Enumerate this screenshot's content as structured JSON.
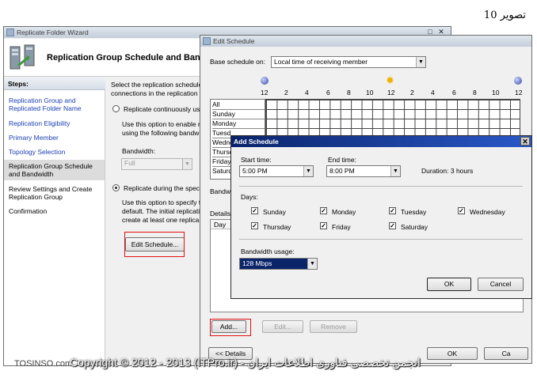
{
  "caption": "تصویر 10",
  "footer": {
    "brand": "TOSINSO.com",
    "copyright": "Copyright © 2012 - 2013 (ITPro.ir) - انجمن تخصصی فناوری اطلاعات ایران"
  },
  "wizard": {
    "title": "Replicate Folder Wizard",
    "header": "Replication Group Schedule and Ban",
    "steps_label": "Steps:",
    "steps": [
      {
        "label": "Replication Group and Replicated Folder Name"
      },
      {
        "label": "Replication Eligibility"
      },
      {
        "label": "Primary Member"
      },
      {
        "label": "Topology Selection"
      },
      {
        "label": "Replication Group Schedule and Bandwidth"
      },
      {
        "label": "Review Settings and Create Replication Group"
      },
      {
        "label": "Confirmation"
      }
    ],
    "intro": "Select the replication schedule",
    "intro2": "connections in the replication",
    "option1": "Replicate continuously us",
    "option1_desc1": "Use this option to enable r",
    "option1_desc2": "using the following bandw",
    "bandwidth_label": "Bandwidth:",
    "bandwidth_value": "Full",
    "option2": "Replicate during the speci",
    "option2_desc1": "Use this option to specify t",
    "option2_desc2": "default. The initial replicati",
    "option2_desc3": "create at least one replica",
    "edit_schedule": "Edit Schedule..."
  },
  "edit_schedule": {
    "title": "Edit Schedule",
    "base_label": "Base schedule on:",
    "base_value": "Local time of receiving member",
    "hours": [
      "12",
      "2",
      "4",
      "6",
      "8",
      "10",
      "12",
      "2",
      "4",
      "6",
      "8",
      "10",
      "12"
    ],
    "days": [
      "All",
      "Sunday",
      "Monday",
      "Tuesd",
      "Wedne",
      "Thursd",
      "Friday",
      "Saturd"
    ],
    "bandwidth_label": "Bandw",
    "details_label": "Details",
    "day_col": "Day",
    "add": "Add...",
    "edit": "Edit...",
    "remove": "Remove",
    "details_btn": "<< Details",
    "ok": "OK",
    "cancel": "Ca"
  },
  "add_schedule": {
    "title": "Add Schedule",
    "start_label": "Start time:",
    "start_value": "5:00 PM",
    "end_label": "End time:",
    "end_value": "8:00 PM",
    "duration": "Duration: 3 hours",
    "days_label": "Days:",
    "days": [
      {
        "label": "Sunday",
        "checked": true
      },
      {
        "label": "Monday",
        "checked": true
      },
      {
        "label": "Tuesday",
        "checked": true
      },
      {
        "label": "Wednesday",
        "checked": true
      },
      {
        "label": "Thursday",
        "checked": true
      },
      {
        "label": "Friday",
        "checked": true
      },
      {
        "label": "Saturday",
        "checked": true
      }
    ],
    "bandwidth_label": "Bandwidth usage:",
    "bandwidth_value": "128 Mbps",
    "ok": "OK",
    "cancel": "Cancel"
  }
}
